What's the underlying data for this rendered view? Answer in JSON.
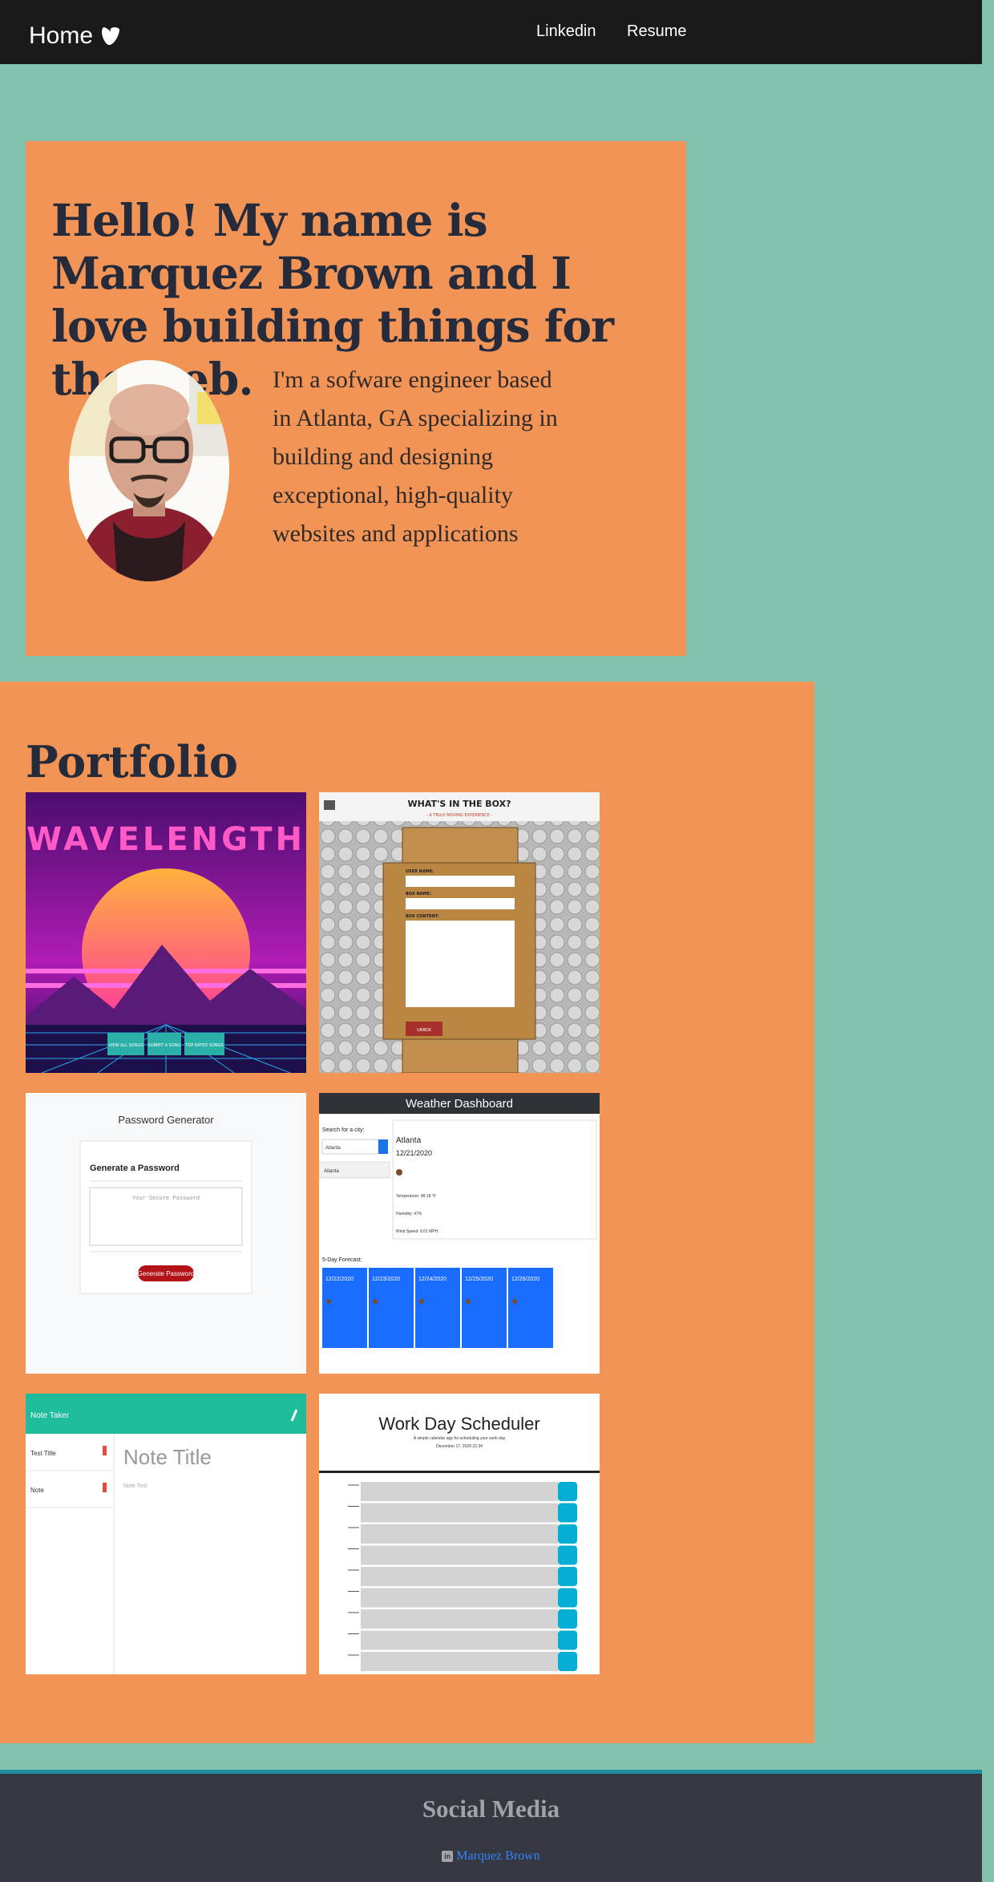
{
  "nav": {
    "brand": "Home",
    "links": [
      "Linkedin",
      "Resume"
    ]
  },
  "hero": {
    "title": "Hello! My name is Marquez Brown and I love building things for the web.",
    "bio": "I'm a sofware engineer based in Atlanta, GA specializing in building and designing exceptional, high-quality websites and applications"
  },
  "portfolio": {
    "title": "Portfolio",
    "projects": [
      {
        "caption": "WAVELENGTH",
        "buttons": [
          "VIEW ALL SONGS",
          "SUBMIT A SONG",
          "TOP RATED SONGS"
        ]
      },
      {
        "caption": "WHAT'S IN THE BOX?",
        "subtitle": "- A TRULY MOVING EXPERIENCE -",
        "fields": [
          "USER NAME:",
          "BOX NAME:",
          "BOX CONTENT:"
        ],
        "button": "UNBOX"
      },
      {
        "caption": "Password Generator",
        "heading": "Generate a Password",
        "placeholder": "Your Secure Password",
        "button": "Generate Password"
      },
      {
        "caption": "Weather Dashboard",
        "search_label": "Search for a city:",
        "search_value": "Atlanta",
        "city": "Atlanta",
        "date": "12/21/2020",
        "temp": "Temperature: 48.18 °F",
        "humidity": "Humidity: 47%",
        "wind": "Wind Speed: 8.01 MPH",
        "forecast_label": "5-Day Forecast:"
      },
      {
        "caption": "Note Taker",
        "notes": [
          "Test Title",
          "Note"
        ],
        "note_title": "Note Title",
        "note_text": "Note Text"
      },
      {
        "caption": "Work Day Scheduler",
        "subtitle": "A simple calendar app for scheduling your work day",
        "date": "December 17, 2020 22:34"
      }
    ]
  },
  "footer": {
    "title": "Social Media",
    "link_text": "Marquez Brown",
    "icon": "linkedin-icon"
  },
  "colors": {
    "navbar": "#1b1a1a",
    "background": "#82c2ae",
    "panel": "#f19456",
    "heading": "#252b3b",
    "footer": "#353841",
    "link": "#3083ff"
  }
}
